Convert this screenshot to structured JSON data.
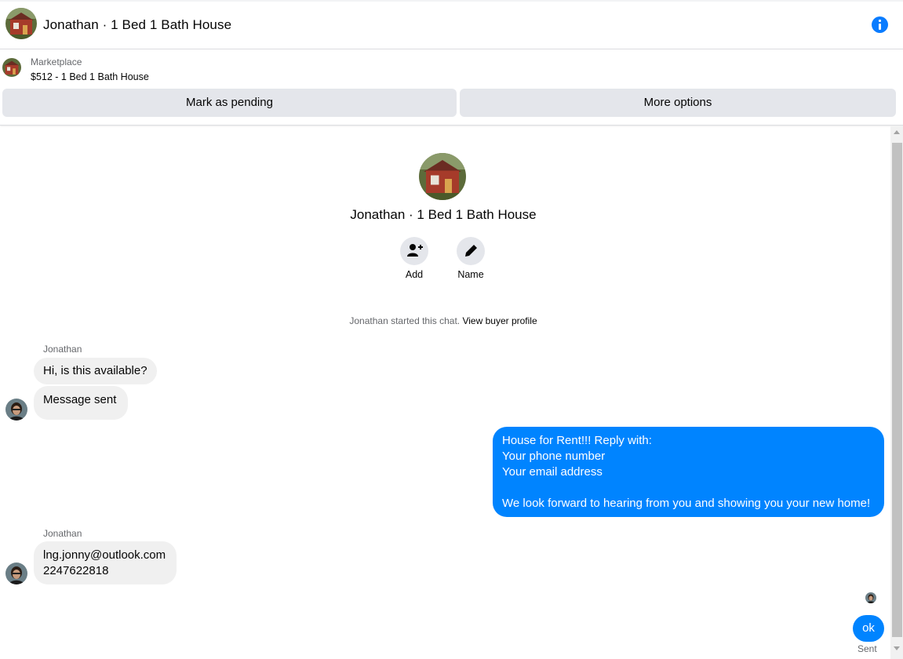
{
  "header": {
    "title": "Jonathan · 1 Bed 1 Bath House",
    "info_icon": "info-icon"
  },
  "listing": {
    "source": "Marketplace",
    "title": "$512 - 1 Bed 1 Bath House",
    "mark_pending_label": "Mark as pending",
    "more_options_label": "More options"
  },
  "profile": {
    "name": "Jonathan · 1 Bed 1 Bath House",
    "actions": [
      {
        "label": "Add",
        "icon": "add-person-icon"
      },
      {
        "label": "Name",
        "icon": "pencil-icon"
      }
    ]
  },
  "chat_start": {
    "text": "Jonathan started this chat.",
    "link": "View buyer profile"
  },
  "messages": [
    {
      "sender": "Jonathan",
      "text": "Hi, is this available?"
    },
    {
      "text": "Message sent"
    },
    {
      "text": "House for Rent!!! Reply with:\nYour phone number\nYour email address\n\nWe look forward to hearing from you and showing you your new home!"
    },
    {
      "sender": "Jonathan",
      "text": "lng.jonny@outlook.com\n2247622818"
    },
    {
      "text": "ok",
      "status": "Sent"
    }
  ],
  "colors": {
    "accent": "#0084ff",
    "info": "#0a7cff",
    "bubble_in": "#f0f0f0",
    "button_bg": "#e4e6eb",
    "muted_text": "#65676b"
  }
}
